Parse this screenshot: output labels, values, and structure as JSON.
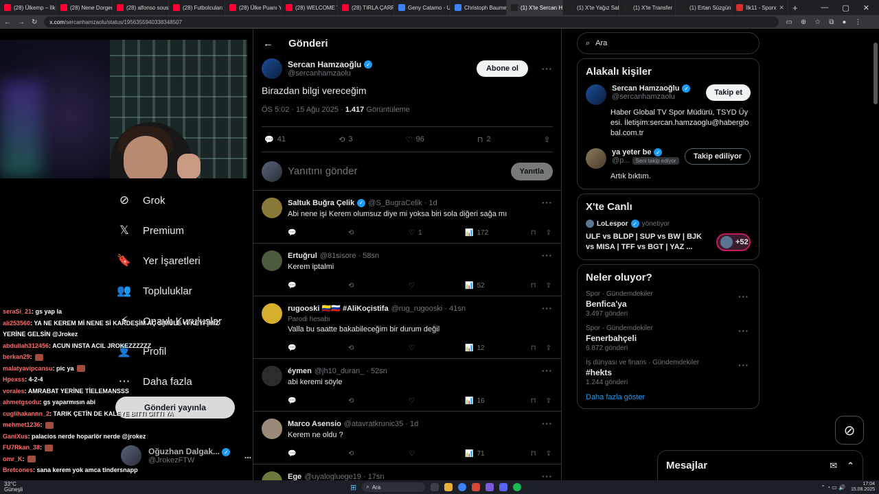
{
  "browser": {
    "tabs": [
      {
        "title": "(28) Ülkemp – İlk",
        "color": "#ff0033"
      },
      {
        "title": "(28) Nene Dorgen",
        "color": "#ff0033"
      },
      {
        "title": "(28) alfonso sous",
        "color": "#ff0033"
      },
      {
        "title": "(28) Futbolcuları",
        "color": "#ff0033"
      },
      {
        "title": "(28) Ülke Puanı Y",
        "color": "#ff0033"
      },
      {
        "title": "(28) WELCOME T",
        "color": "#ff0033"
      },
      {
        "title": "(28) TIRLA ÇARP",
        "color": "#ff0033"
      },
      {
        "title": "Geny Catamo - U",
        "color": "#3b82f6"
      },
      {
        "title": "Christoph Baume",
        "color": "#3b82f6"
      },
      {
        "title": "(1) X'te Sercan H",
        "color": "#222222",
        "active": true
      },
      {
        "title": "(1) X'te Yağız Sab",
        "color": "#222222"
      },
      {
        "title": "(1) X'te Transfer",
        "color": "#222222"
      },
      {
        "title": "(1) Ertan Süzgün",
        "color": "#222222"
      },
      {
        "title": "İlk11 - Sporx",
        "color": "#d92d2d"
      }
    ],
    "url_domain": "x.com",
    "url_path": "/sercanhamzaolu/status/1956355940338348507"
  },
  "leftnav": {
    "items": [
      {
        "label": "Grok",
        "icon": "grok-icon",
        "glyph": "⊘"
      },
      {
        "label": "Premium",
        "icon": "x-logo-icon",
        "glyph": "𝕏"
      },
      {
        "label": "Yer İşaretleri",
        "icon": "bookmark-icon",
        "glyph": "🔖"
      },
      {
        "label": "Topluluklar",
        "icon": "communities-icon",
        "glyph": "👥"
      },
      {
        "label": "Onaylı Kuruluşlar",
        "icon": "lightning-icon",
        "glyph": "⚡"
      },
      {
        "label": "Profil",
        "icon": "profile-icon",
        "glyph": "👤"
      },
      {
        "label": "Daha fazla",
        "icon": "more-icon",
        "glyph": "⋯"
      }
    ],
    "post_button": "Gönderi yayınla",
    "profile": {
      "name": "Oğuzhan Dalgak...",
      "handle": "@JrokezFTW",
      "more": "..."
    }
  },
  "chat": [
    {
      "user": "seraSi_21",
      "text": ": gs yap la"
    },
    {
      "user": "ali253560",
      "text": ": YA NE KEREM Mİ NENE Sİ KARDEŞİM AÇ SİMÜLE Yİ KEYFİMİZ"
    },
    {
      "user": "",
      "text": "YERİNE GELSİN @Jrokez"
    },
    {
      "user": "abdullah312456",
      "text": ": ACUN INSTA ACIL JROKEZZZZZZ"
    },
    {
      "user": "berkan29",
      "text": ":",
      "emote": true
    },
    {
      "user": "malatyavipcansu",
      "text": ": pic ya",
      "emote": true
    },
    {
      "user": "Hpexss",
      "text": ": 4-2-4"
    },
    {
      "user": "vorales",
      "text": ": AMRABAT YERİNE TİELEMANSSS"
    },
    {
      "user": "ahmetgsodu",
      "text": ": gs yaparmısın abi"
    },
    {
      "user": "cuglihakannn_2",
      "text": ": TARIK ÇETİN DE KALEYE BITTI GITTI YA"
    },
    {
      "user": "mehmet1236",
      "text": ":",
      "emote": true
    },
    {
      "user": "GaniXus",
      "text": ": palacios nerde hoparlör nerde @jrokez"
    },
    {
      "user": "FU7Rkan_38",
      "text": ":",
      "emote": true
    },
    {
      "user": "omr_K",
      "text": ":",
      "emote": true
    },
    {
      "user": "Bretcones",
      "text": ": sana kerem yok amca tindersnapp"
    }
  ],
  "main": {
    "header": "Gönderi",
    "post": {
      "name": "Sercan Hamzaoğlu",
      "handle": "@sercanhamzaolu",
      "follow": "Abone ol",
      "text": "Birazdan bilgi vereceğim",
      "time": "ÖS 5:02 · 15 Ağu 2025 · ",
      "views": "1.417",
      "views_label": " Görüntüleme",
      "stats": {
        "replies": "41",
        "reposts": "3",
        "likes": "96",
        "bookmarks": "2"
      }
    },
    "reply_placeholder": "Yanıtını gönder",
    "reply_button": "Yanıtla",
    "replies": [
      {
        "name": "Saltuk Buğra Çelik",
        "handle": "@S_BugraCelik · 1d",
        "verified": true,
        "text": "Abi nene işi Kerem olumsuz diye mi yoksa biri sola diğeri sağa mı",
        "likes": "1",
        "views": "172",
        "avatar": "#8a7a3a"
      },
      {
        "name": "Ertuğrul",
        "handle": "@81sisore · 58sn",
        "verified": false,
        "text": "Kerem iptalmi",
        "likes": "",
        "views": "52",
        "avatar": "#4c5a3e"
      },
      {
        "name": "rugooski 🇨🇴🇷🇺 #AliKoçistifa",
        "handle": "@rug_rugooski · 41sn",
        "verified": false,
        "parody": "Parodi hesabı",
        "text": "Valla bu saatte bakabileceğim bir durum değil",
        "likes": "",
        "views": "12",
        "avatar": "#d6b02a"
      },
      {
        "name": "éymen",
        "handle": "@jh10_duran_ · 52sn",
        "verified": false,
        "text": "abi keremi söyle",
        "likes": "",
        "views": "16",
        "avatar": "#2c2c2c"
      },
      {
        "name": "Marco Asensio",
        "handle": "@atavratkrunic35 · 1d",
        "verified": false,
        "text": "Kerem ne oldu ?",
        "likes": "",
        "views": "71",
        "avatar": "#9a8a7a"
      },
      {
        "name": "Ege",
        "handle": "@uyalogluege19 · 17sn",
        "verified": false,
        "text": "",
        "likes": "",
        "views": "",
        "avatar": "#6a7a3a"
      }
    ]
  },
  "right": {
    "search_placeholder": "Ara",
    "related_title": "Alakalı kişiler",
    "related": [
      {
        "name": "Sercan Hamzaoğlu",
        "handle": "@sercanhamzaolu",
        "button": "Takip et",
        "bio": "Haber Global TV Spor Müdürü, TSYD Üyesi. İletişim:sercan.hamzaoglu@haberglobal.com.tr"
      },
      {
        "name": "ya yeter be",
        "handle": "@p...",
        "tag": "Seni takip ediyor",
        "button": "Takip ediliyor",
        "bio": "Artık bıktım."
      }
    ],
    "live_title": "X'te Canlı",
    "live": {
      "host": "LoLespor",
      "host_sub": "yönetiyor",
      "title": "ULF vs BLDP | SUP vs BW | BJK vs MISA | TFF vs BGT | YAZ ...",
      "count": "+52"
    },
    "trends_title": "Neler oluyor?",
    "trends": [
      {
        "category": "Spor · Gündemdekiler",
        "name": "Benfica'ya",
        "count": "3.497 gönderi"
      },
      {
        "category": "Spor · Gündemdekiler",
        "name": "Fenerbahçeli",
        "count": "6.872 gönderi"
      },
      {
        "category": "İş dünyası ve finans · Gündemdekiler",
        "name": "#hekts",
        "count": "1.244 gönderi"
      }
    ],
    "show_more": "Daha fazla göster"
  },
  "messages": {
    "label": "Mesajlar"
  },
  "taskbar": {
    "weather_temp": "33°C",
    "weather_label": "Güneşli",
    "search": "Ara",
    "time": "17:04",
    "date": "15.08.2025"
  }
}
